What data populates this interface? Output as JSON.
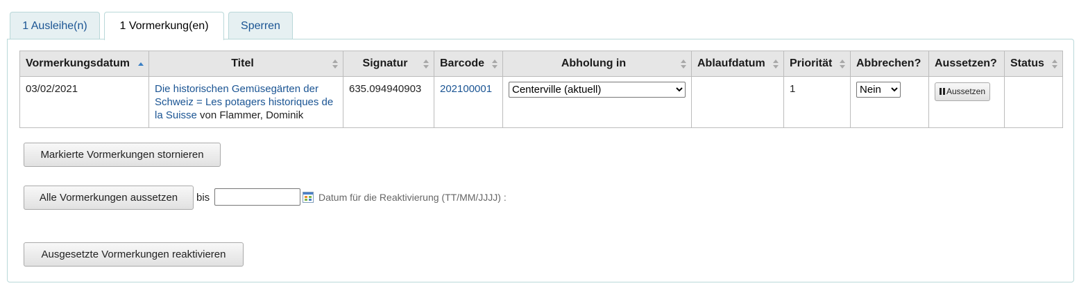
{
  "tabs": [
    {
      "label": "1 Ausleihe(n)",
      "active": false
    },
    {
      "label": "1 Vormerkung(en)",
      "active": true
    },
    {
      "label": "Sperren",
      "active": false
    }
  ],
  "table": {
    "headers": {
      "date": "Vormerkungsdatum",
      "title": "Titel",
      "callnumber": "Signatur",
      "barcode": "Barcode",
      "pickup": "Abholung in",
      "expiration": "Ablaufdatum",
      "priority": "Priorität",
      "cancel": "Abbrechen?",
      "suspend": "Aussetzen?",
      "status": "Status"
    },
    "sort_column": "date",
    "sort_direction": "ascending",
    "rows": [
      {
        "date": "03/02/2021",
        "title_link": "Die historischen Gemüsegärten der Schweiz = Les potagers historiques de la Suisse",
        "author": " von Flammer, Dominik",
        "callnumber": "635.094940903",
        "barcode": "202100001",
        "pickup_selected": "Centerville (aktuell)",
        "expiration": "",
        "priority": "1",
        "cancel_selected": "Nein",
        "suspend_button": "Aussetzen",
        "status": ""
      }
    ]
  },
  "actions": {
    "cancel_marked": "Markierte Vormerkungen stornieren",
    "suspend_all": "Alle Vormerkungen aussetzen",
    "until_label": "bis",
    "date_hint": "Datum für die Reaktivierung (TT/MM/JJJJ) :",
    "date_value": "",
    "reactivate": "Ausgesetzte Vormerkungen reaktivieren"
  },
  "icons": {
    "sort": "sort-icon",
    "pause": "pause-icon",
    "calendar": "calendar-icon"
  },
  "colors": {
    "link": "#1a5493",
    "tab_inactive_bg": "#e6f0f2",
    "panel_border": "#b9d8d9",
    "header_bg": "#e6e6e6"
  }
}
